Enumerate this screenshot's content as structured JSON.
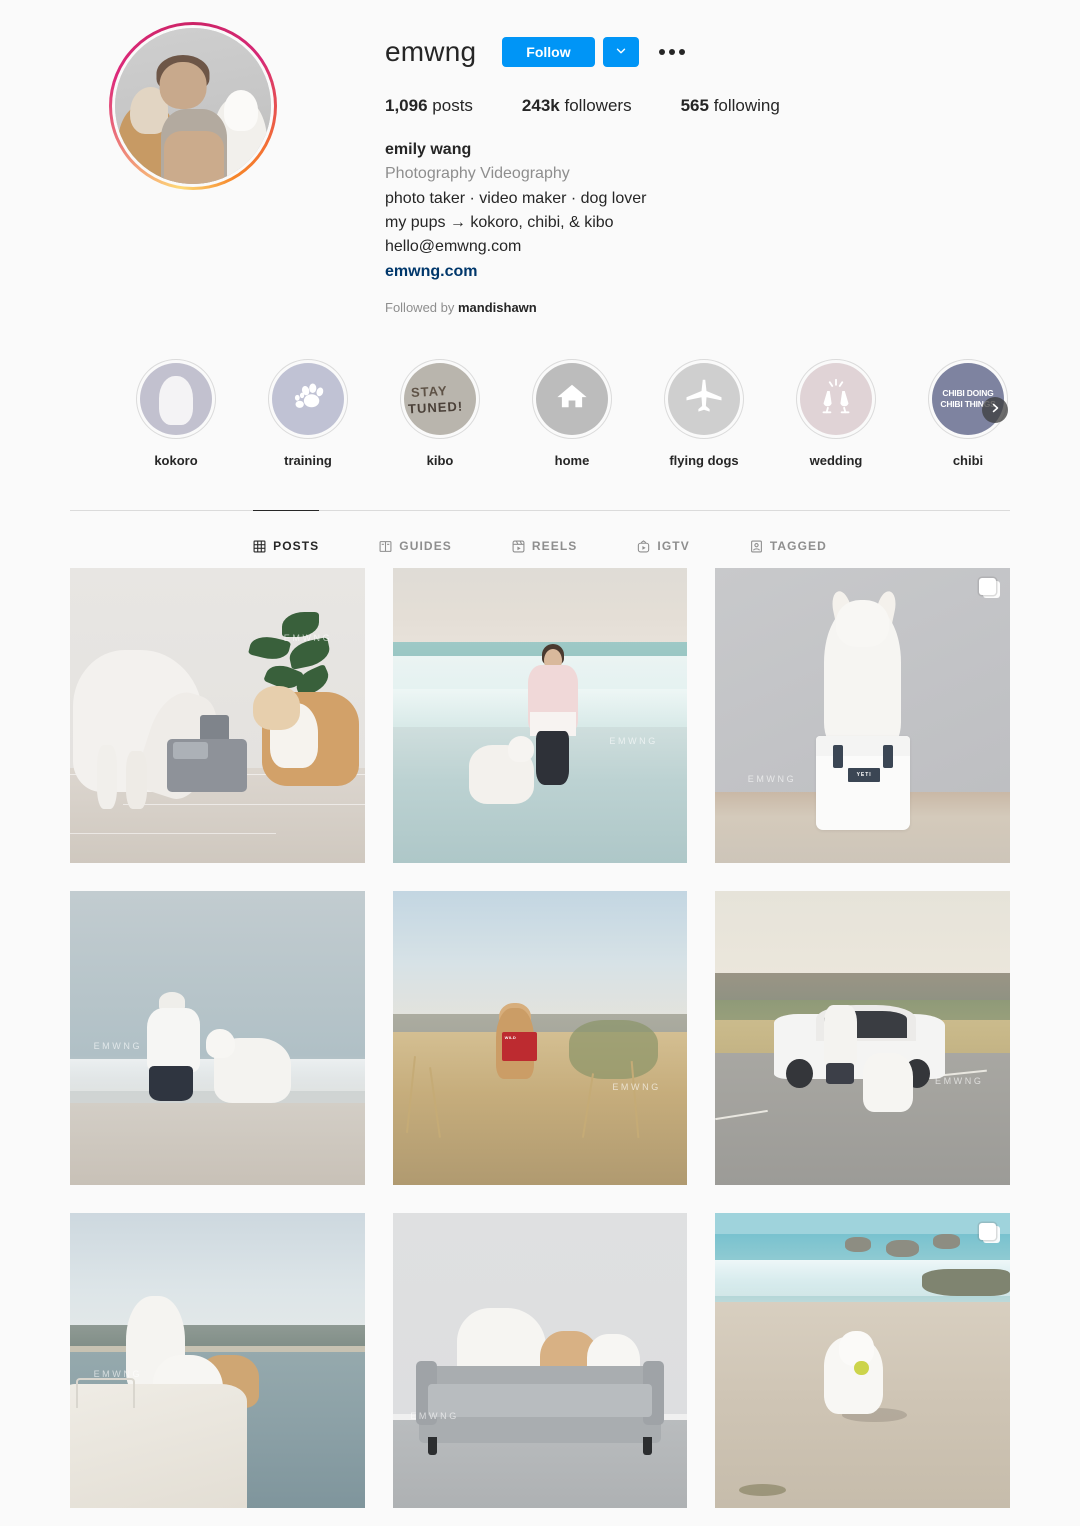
{
  "profile": {
    "username": "emwng",
    "follow_button": "Follow",
    "chevron_icon": "chevron-down-icon",
    "more_icon": "more-options-icon",
    "avatar_alt": "emily wang with two dogs",
    "stats": [
      {
        "value": "1,096",
        "label": "posts"
      },
      {
        "value": "243k",
        "label": "followers"
      },
      {
        "value": "565",
        "label": "following"
      }
    ],
    "full_name": "emily wang",
    "category": "Photography Videography",
    "bio_lines": [
      "photo taker · video maker · dog lover",
      "my pups → kokoro, chibi, & kibo",
      "hello@emwng.com"
    ],
    "website": "emwng.com",
    "followed_by_prefix": "Followed by ",
    "followed_by_names": "mandishawn"
  },
  "highlights": {
    "next_icon": "chevron-right-icon",
    "items": [
      {
        "label": "kokoro",
        "style": "kokoro",
        "color": "#c2c1cf"
      },
      {
        "label": "training",
        "style": "paw",
        "color": "#c0c2d4"
      },
      {
        "label": "kibo",
        "style": "staytuned",
        "color": "#b9b5ad",
        "text_line1": "STAY",
        "text_line2": "TUNED!"
      },
      {
        "label": "home",
        "style": "house",
        "color": "#bcbcbc"
      },
      {
        "label": "flying dogs",
        "style": "plane",
        "color": "#cfcfcf"
      },
      {
        "label": "wedding",
        "style": "cheers",
        "color": "#e0d3d6"
      },
      {
        "label": "chibi",
        "style": "chibi",
        "color": "#7e83a0",
        "text": "CHIBI DOING CHIBI THINGS"
      }
    ]
  },
  "tabs": [
    {
      "label": "POSTS",
      "icon": "grid-icon",
      "active": true
    },
    {
      "label": "GUIDES",
      "icon": "guides-icon",
      "active": false
    },
    {
      "label": "REELS",
      "icon": "reels-icon",
      "active": false
    },
    {
      "label": "IGTV",
      "icon": "igtv-icon",
      "active": false
    },
    {
      "label": "TAGGED",
      "icon": "tagged-icon",
      "active": false
    }
  ],
  "grid": {
    "watermark": "EMWNG",
    "posts": [
      {
        "id": "post-1",
        "scene": "p1",
        "alt": "white dog and corgi at water fountain indoors",
        "multi": false
      },
      {
        "id": "post-2",
        "scene": "p2",
        "alt": "woman and white dog in ocean surf",
        "multi": false
      },
      {
        "id": "post-3",
        "scene": "p3",
        "alt": "white dog sitting on YETI cooler",
        "multi": true,
        "brand_text": "YETI"
      },
      {
        "id": "post-4",
        "scene": "p4",
        "alt": "woman crouching with white dog at shoreline",
        "multi": false
      },
      {
        "id": "post-5",
        "scene": "p5",
        "alt": "corgi with red dog food bag in golden grass",
        "multi": false,
        "bag_text": "WILD"
      },
      {
        "id": "post-6",
        "scene": "p6",
        "alt": "woman walking white dog beside white car on road",
        "multi": false
      },
      {
        "id": "post-7",
        "scene": "p7",
        "alt": "three dogs on a boat at a lake",
        "multi": false
      },
      {
        "id": "post-8",
        "scene": "p8",
        "alt": "three dogs lying on a gray couch",
        "multi": false
      },
      {
        "id": "post-9",
        "scene": "p9",
        "alt": "white dog running on beach with tennis ball",
        "multi": true
      }
    ]
  },
  "colors": {
    "accent_blue": "#0095f6",
    "link_blue": "#00376b",
    "text_primary": "#262626",
    "text_secondary": "#8e8e8e",
    "page_bg": "#fafafa",
    "border": "#dbdbdb"
  }
}
